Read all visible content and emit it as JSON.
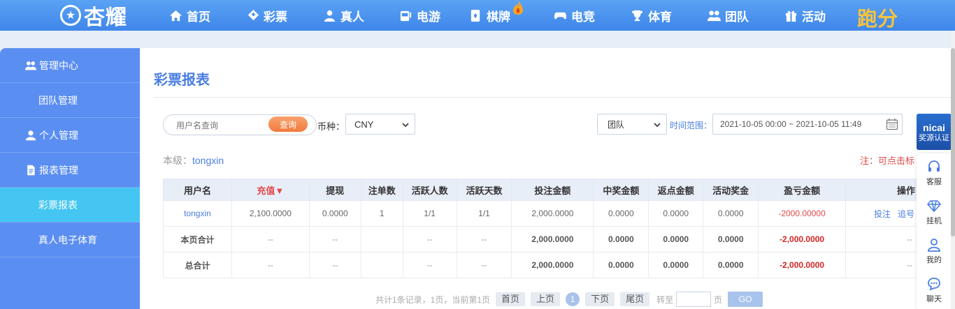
{
  "brand": {
    "logo_text": "杏耀"
  },
  "nav": {
    "items": [
      {
        "label": "首页",
        "icon": "home-icon"
      },
      {
        "label": "彩票",
        "icon": "lottery-icon"
      },
      {
        "label": "真人",
        "icon": "person-icon"
      },
      {
        "label": "电游",
        "icon": "slot-icon"
      },
      {
        "label": "棋牌",
        "icon": "cards-icon"
      },
      {
        "label": "电竞",
        "icon": "gamepad-icon"
      },
      {
        "label": "体育",
        "icon": "trophy-icon"
      },
      {
        "label": "团队",
        "icon": "team-icon"
      },
      {
        "label": "活动",
        "icon": "gift-icon"
      }
    ],
    "paofen": "跑分"
  },
  "sidebar": {
    "items": [
      {
        "label": "管理中心",
        "type": "group",
        "icon": "users-icon"
      },
      {
        "label": "团队管理",
        "type": "sub"
      },
      {
        "label": "个人管理",
        "type": "group",
        "icon": "user-icon"
      },
      {
        "label": "报表管理",
        "type": "group",
        "icon": "report-icon"
      },
      {
        "label": "彩票报表",
        "type": "sub",
        "active": true
      },
      {
        "label": "真人电子体育",
        "type": "sub"
      }
    ]
  },
  "main": {
    "title": "彩票报表",
    "search": {
      "placeholder": "用户名查询",
      "button": "查询"
    },
    "currency": {
      "label": "币种：",
      "value": "CNY"
    },
    "scope": {
      "value": "团队"
    },
    "time_range": {
      "label": "时间范围：",
      "value": "2021-10-05 00:00 ~ 2021-10-05 11:49"
    },
    "level": {
      "prefix": "本级：",
      "username": "tongxin"
    },
    "note": "注：可点击标",
    "table": {
      "headers": [
        "用户名",
        "充值▼",
        "提现",
        "注单数",
        "活跃人数",
        "活跃天数",
        "投注金额",
        "中奖金额",
        "返点金额",
        "活动奖金",
        "盈亏金额",
        "操作"
      ],
      "row": {
        "username": "tongxin",
        "recharge": "2,100.0000",
        "withdraw": "0.0000",
        "orders": "1",
        "active_users": "1/1",
        "active_days": "1/1",
        "bet": "2,000.0000",
        "win": "0.0000",
        "rebate": "0.0000",
        "bonus": "0.0000",
        "profit": "-2000.00000",
        "ops": [
          "投注",
          "追号"
        ]
      },
      "page_total": {
        "label": "本页合计",
        "recharge": "--",
        "withdraw": "--",
        "orders": "",
        "active_users": "--",
        "active_days": "--",
        "bet": "2,000.0000",
        "win": "0.0000",
        "rebate": "0.0000",
        "bonus": "0.0000",
        "profit": "-2,000.0000",
        "ops": "--"
      },
      "grand_total": {
        "label": "总合计",
        "recharge": "--",
        "withdraw": "--",
        "orders": "",
        "active_users": "--",
        "active_days": "--",
        "bet": "2,000.0000",
        "win": "0.0000",
        "rebate": "0.0000",
        "bonus": "0.0000",
        "profit": "-2,000.0000",
        "ops": "--"
      }
    },
    "pager": {
      "summary": "共计1条记录，1页，当前第1页",
      "first": "首页",
      "prev": "上页",
      "current": "1",
      "next": "下页",
      "last": "尾页",
      "goto_label": "转至",
      "page_unit": "页",
      "go": "GO"
    }
  },
  "float_panel": {
    "top_brand": "nicai",
    "top_label": "奖源认证",
    "items": [
      {
        "label": "客服",
        "icon": "headset-icon"
      },
      {
        "label": "挂机",
        "icon": "diamond-icon"
      },
      {
        "label": "我的",
        "icon": "profile-icon"
      },
      {
        "label": "聊天",
        "icon": "chat-icon"
      }
    ]
  },
  "colors": {
    "nav_bg": "#4a90ee",
    "sidebar_bg": "#5b8ef1",
    "sidebar_active": "#45c6f2",
    "accent": "#4a7ee0",
    "danger": "#e04848"
  }
}
